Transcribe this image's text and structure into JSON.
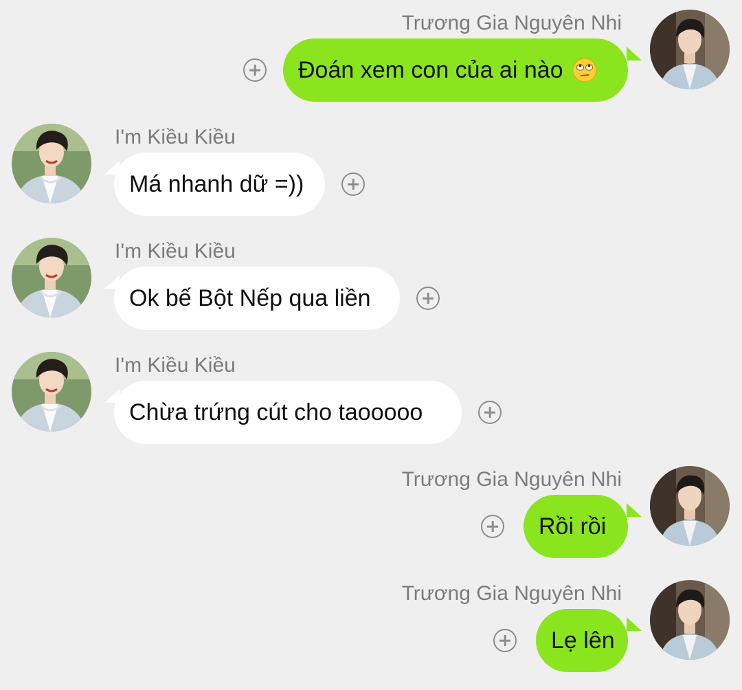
{
  "messages": [
    {
      "sender": "Trương Gia Nguyên Nhi",
      "text": "Đoán xem con của ai nào",
      "emoji": "face-with-rolling-eyes-emoji"
    },
    {
      "sender": "I'm Kiều Kiều",
      "text": "Má nhanh dữ =))"
    },
    {
      "sender": "I'm Kiều Kiều",
      "text": "Ok bế Bột Nếp qua liền"
    },
    {
      "sender": "I'm Kiều Kiều",
      "text": "Chừa trứng cút cho taooooo"
    },
    {
      "sender": "Trương Gia Nguyên Nhi",
      "text": "Rồi rồi"
    },
    {
      "sender": "Trương Gia Nguyên Nhi",
      "text": "Lẹ lên"
    }
  ],
  "colors": {
    "background": "#efefef",
    "outgoing_bubble": "#8ae51e",
    "incoming_bubble": "#ffffff",
    "sender_name": "#7b7b7b",
    "react_icon": "#8c8c8c"
  },
  "icons": {
    "react": "add-reaction-icon",
    "avatar": "avatar-photo"
  }
}
